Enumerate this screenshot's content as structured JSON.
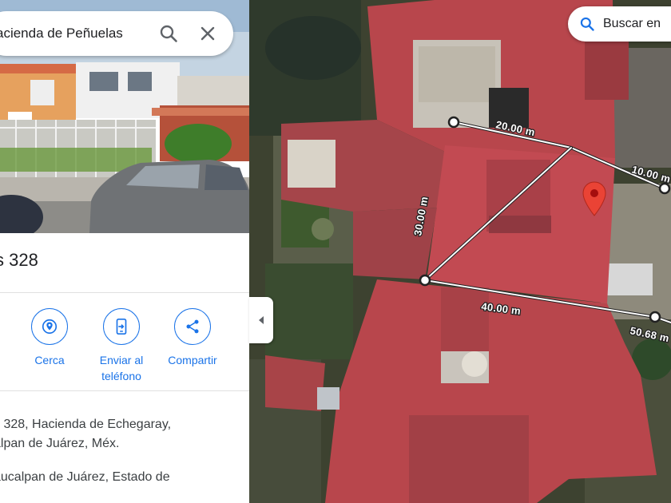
{
  "panel": {
    "search": {
      "query": "acienda de Peñuelas"
    },
    "place_title": "s 328",
    "actions": [
      {
        "label": "Cerca",
        "icon": "nearby-icon"
      },
      {
        "label": "Enviar al teléfono",
        "icon": "send-to-phone-icon"
      },
      {
        "label": "Compartir",
        "icon": "share-icon"
      }
    ],
    "address_line1": "s 328, Hacienda de Echegaray,",
    "address_line2": "alpan de Juárez, Méx.",
    "plus_code_line": "aucalpan de Juárez, Estado de"
  },
  "map": {
    "search_label": "Buscar en",
    "measurements": [
      "20.00 m",
      "10.00 m",
      "30.00 m",
      "40.00 m",
      "50.68 m"
    ],
    "pin_color": "#ea4335"
  },
  "colors": {
    "accent": "#1a73e8",
    "roof": "#b8464c"
  }
}
